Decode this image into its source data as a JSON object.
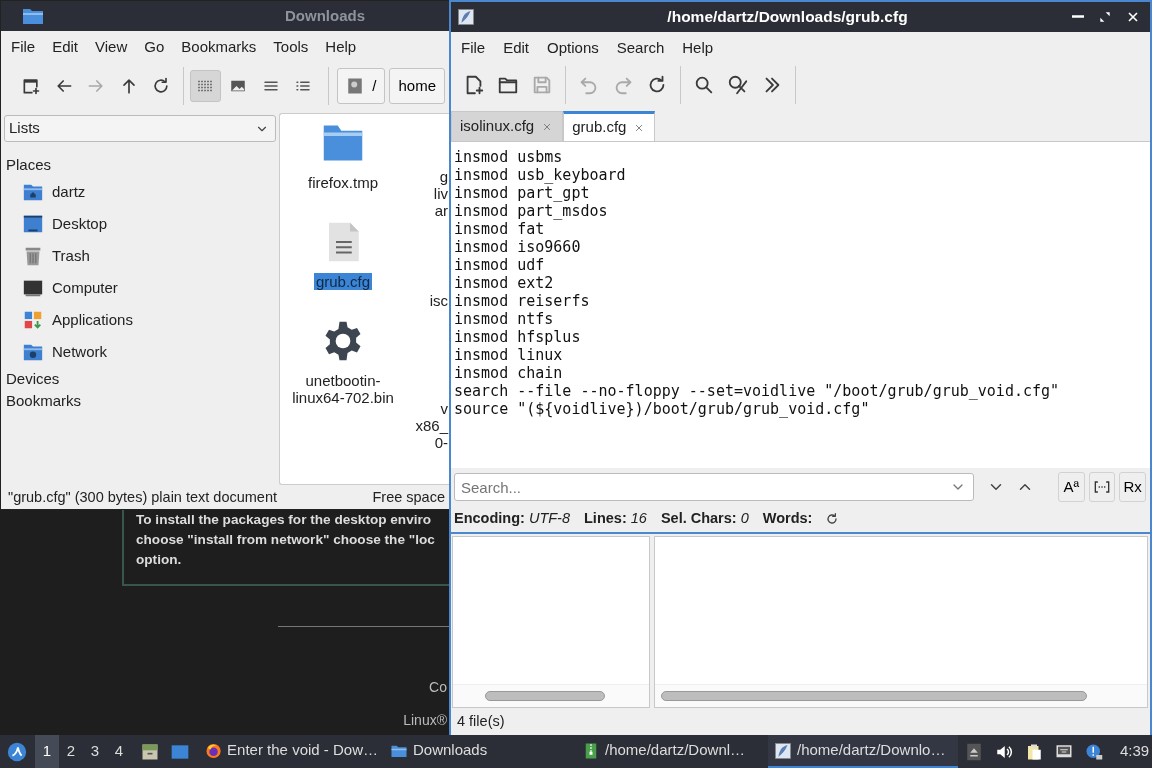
{
  "background_page": {
    "paragraph_lines": [
      "To install the packages for the desktop enviro",
      "choose \"install from network\" choose the \"loc",
      "option."
    ],
    "footer": [
      "Co",
      "Linux®"
    ]
  },
  "file_manager": {
    "title": "Downloads",
    "menu": [
      "File",
      "Edit",
      "View",
      "Go",
      "Bookmarks",
      "Tools",
      "Help"
    ],
    "nav_buttons": [
      {
        "kind": "new-tab",
        "disabled": false
      },
      {
        "kind": "back",
        "disabled": false
      },
      {
        "kind": "forward",
        "disabled": true
      },
      {
        "kind": "up",
        "disabled": false
      },
      {
        "kind": "reload",
        "disabled": false
      }
    ],
    "view_modes": [
      {
        "kind": "icons",
        "selected": true
      },
      {
        "kind": "thumbnails",
        "selected": false
      },
      {
        "kind": "compact",
        "selected": false
      },
      {
        "kind": "detailed",
        "selected": false
      }
    ],
    "path": [
      {
        "label": "/",
        "kind": "root"
      },
      {
        "label": "home",
        "kind": "folder"
      }
    ],
    "side_pane_mode": "Lists",
    "sections": [
      {
        "title": "Places",
        "items": [
          {
            "label": "dartz",
            "kind": "home"
          },
          {
            "label": "Desktop",
            "kind": "desktop"
          },
          {
            "label": "Trash",
            "kind": "trash"
          },
          {
            "label": "Computer",
            "kind": "computer"
          },
          {
            "label": "Applications",
            "kind": "applications"
          },
          {
            "label": "Network",
            "kind": "network"
          }
        ]
      },
      {
        "title": "Devices"
      },
      {
        "title": "Bookmarks"
      }
    ],
    "files": [
      {
        "lines": [
          "firefox.tmp"
        ],
        "kind": "folder",
        "selected": false
      },
      {
        "lines": [
          "grub.cfg"
        ],
        "kind": "text",
        "selected": true
      },
      {
        "lines": [
          "unetbootin-",
          "linux64-702.bin"
        ],
        "kind": "executable",
        "selected": false
      }
    ],
    "clipped_files": [
      {
        "lines": [
          "g",
          "liv",
          "ar"
        ]
      },
      {
        "lines": [
          "isc"
        ]
      },
      {
        "lines": [
          "v",
          "x86_",
          "0-"
        ]
      }
    ],
    "status": "\"grub.cfg\" (300 bytes) plain text document",
    "free_space": "Free space"
  },
  "editor": {
    "title": "/home/dartz/Downloads/grub.cfg",
    "menu": [
      "File",
      "Edit",
      "Options",
      "Search",
      "Help"
    ],
    "toolbar": [
      {
        "kind": "new",
        "disabled": false
      },
      {
        "kind": "open",
        "disabled": false
      },
      {
        "kind": "save",
        "disabled": true
      },
      {
        "kind": "separator"
      },
      {
        "kind": "undo",
        "disabled": true
      },
      {
        "kind": "redo",
        "disabled": true
      },
      {
        "kind": "reload",
        "disabled": false
      },
      {
        "kind": "separator"
      },
      {
        "kind": "find",
        "disabled": false
      },
      {
        "kind": "replace",
        "disabled": false
      },
      {
        "kind": "more",
        "disabled": false
      }
    ],
    "tabs": [
      {
        "label": "isolinux.cfg",
        "selected": false
      },
      {
        "label": "grub.cfg",
        "selected": true
      }
    ],
    "lines": [
      "insmod usbms",
      "insmod usb_keyboard",
      "insmod part_gpt",
      "insmod part_msdos",
      "insmod fat",
      "insmod iso9660",
      "insmod udf",
      "insmod ext2",
      "insmod reiserfs",
      "insmod ntfs",
      "insmod hfsplus",
      "insmod linux",
      "insmod chain",
      "search --file --no-floppy --set=voidlive \"/boot/grub/grub_void.cfg\"",
      "source \"(${voidlive})/boot/grub/grub_void.cfg\""
    ],
    "search": {
      "placeholder": "Search..."
    },
    "search_options": [
      {
        "kind": "match-case",
        "label": "Aª"
      },
      {
        "kind": "whole-word"
      },
      {
        "kind": "regex",
        "label": "Rx"
      }
    ],
    "status": [
      {
        "label": "Encoding:",
        "value": "UTF-8"
      },
      {
        "label": "Lines:",
        "value": "16"
      },
      {
        "label": "Sel. Chars:",
        "value": "0"
      },
      {
        "label": "Words:"
      }
    ],
    "file_count": "4 file(s)"
  },
  "taskbar": {
    "workspaces": [
      {
        "label": "1",
        "selected": true
      },
      {
        "label": "2",
        "selected": false
      },
      {
        "label": "3",
        "selected": false
      },
      {
        "label": "4",
        "selected": false
      }
    ],
    "tasks": [
      {
        "label": "Enter the void - Dow…",
        "kind": "browser",
        "selected": false
      },
      {
        "label": "Downloads",
        "kind": "folder",
        "selected": false
      },
      {
        "label": "/home/dartz/Downl…",
        "kind": "archive",
        "selected": false
      },
      {
        "label": "/home/dartz/Downlo…",
        "kind": "editor",
        "selected": true
      }
    ],
    "clock": "4:39"
  }
}
